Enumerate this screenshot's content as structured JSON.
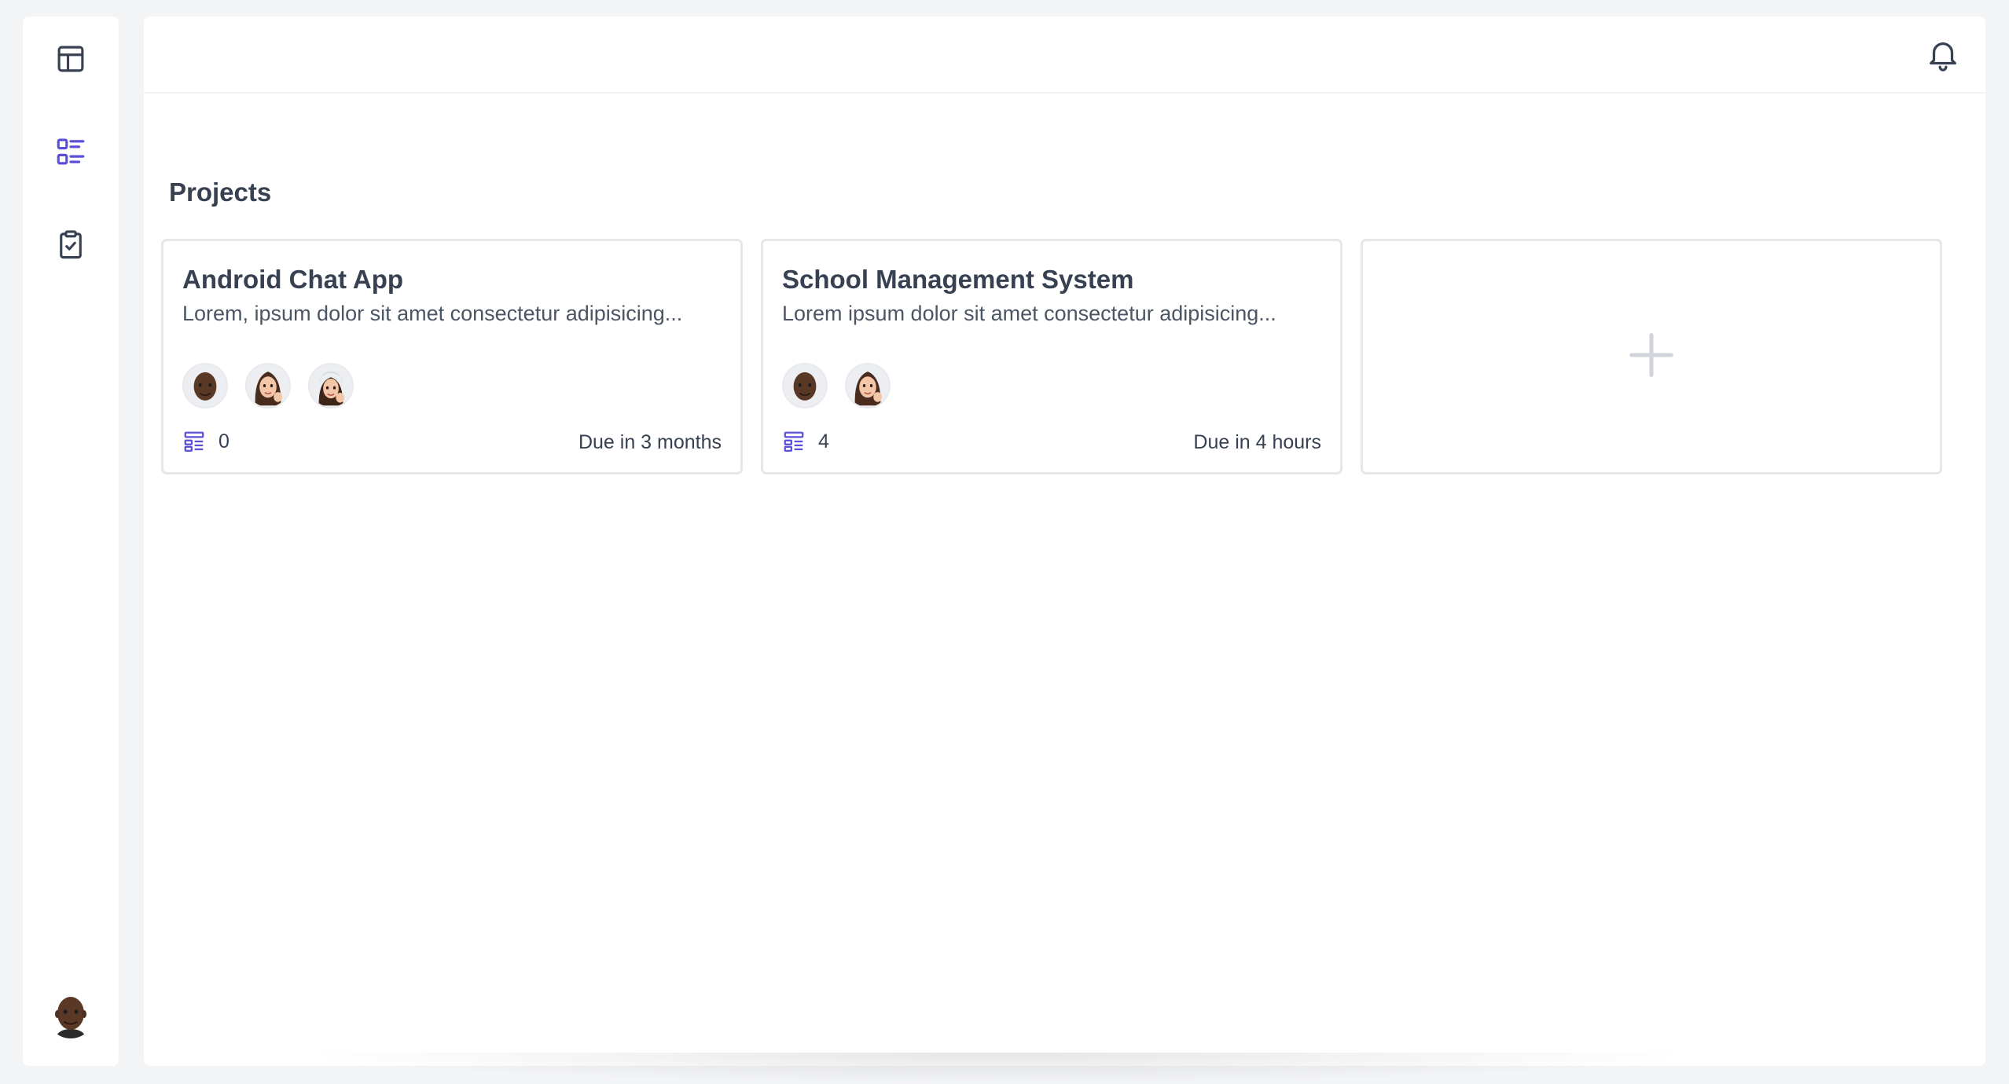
{
  "sidebar": {
    "items": [
      {
        "name": "dashboard",
        "icon": "layout-icon",
        "active": false
      },
      {
        "name": "projects",
        "icon": "list-icon",
        "active": true
      },
      {
        "name": "tasks",
        "icon": "clipboard-check-icon",
        "active": false
      }
    ],
    "user_avatar": "memoji-avatar"
  },
  "header": {
    "notifications_icon": "bell-icon"
  },
  "main": {
    "section_title": "Projects",
    "projects": [
      {
        "title": "Android Chat App",
        "description": "Lorem, ipsum dolor sit amet consectetur adipisicing...",
        "members": 3,
        "task_count": "0",
        "due": "Due in 3 months"
      },
      {
        "title": "School Management System",
        "description": "Lorem ipsum dolor sit amet consectetur adipisicing...",
        "members": 2,
        "task_count": "4",
        "due": "Due in 4 hours"
      }
    ],
    "add_project_icon": "plus-icon"
  },
  "colors": {
    "accent": "#5b4fd8",
    "icon": "#374151",
    "border": "#e5e7eb",
    "background": "#f3f4f6"
  }
}
